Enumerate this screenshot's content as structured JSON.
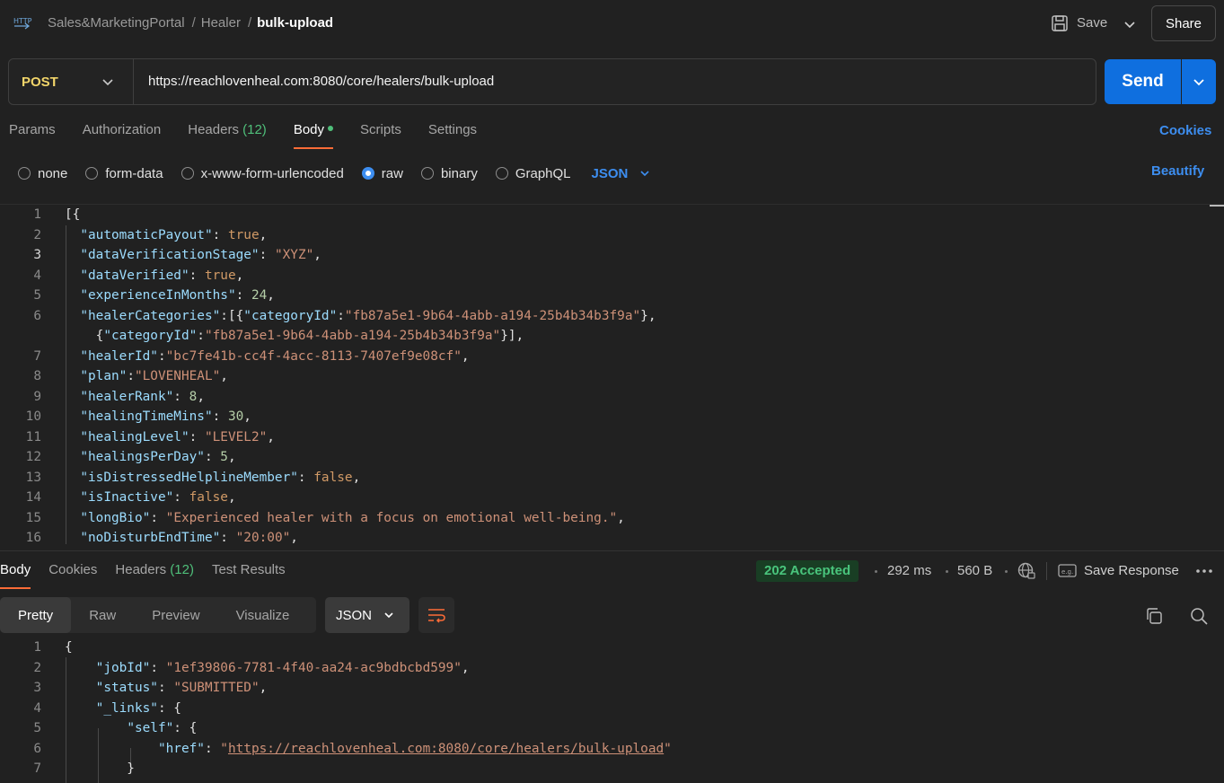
{
  "breadcrumb": {
    "collection": "Sales&MarketingPortal",
    "folder": "Healer",
    "request": "bulk-upload",
    "separator": "/"
  },
  "toolbar": {
    "save_label": "Save",
    "share_label": "Share"
  },
  "request": {
    "method": "POST",
    "url": "https://reachlovenheal.com:8080/core/healers/bulk-upload",
    "send_label": "Send"
  },
  "request_tabs": {
    "params": "Params",
    "authorization": "Authorization",
    "headers": "Headers",
    "headers_count": "(12)",
    "body": "Body",
    "scripts": "Scripts",
    "settings": "Settings",
    "cookies": "Cookies"
  },
  "body_options": {
    "none": "none",
    "form_data": "form-data",
    "urlencoded": "x-www-form-urlencoded",
    "raw": "raw",
    "binary": "binary",
    "graphql": "GraphQL",
    "selected": "raw",
    "format": "JSON",
    "beautify": "Beautify"
  },
  "request_body_lines": [
    {
      "n": "1",
      "text": "[{"
    },
    {
      "n": "2",
      "text": "  \"automaticPayout\": true,"
    },
    {
      "n": "3",
      "text": "  \"dataVerificationStage\": \"XYZ\","
    },
    {
      "n": "4",
      "text": "  \"dataVerified\": true,"
    },
    {
      "n": "5",
      "text": "  \"experienceInMonths\": 24,"
    },
    {
      "n": "6",
      "text": "  \"healerCategories\":[{\"categoryId\":\"fb87a5e1-9b64-4abb-a194-25b4b34b3f9a\"},"
    },
    {
      "n": "",
      "text": "    {\"categoryId\":\"fb87a5e1-9b64-4abb-a194-25b4b34b3f9a\"}],"
    },
    {
      "n": "7",
      "text": "  \"healerId\":\"bc7fe41b-cc4f-4acc-8113-7407ef9e08cf\","
    },
    {
      "n": "8",
      "text": "  \"plan\":\"LOVENHEAL\","
    },
    {
      "n": "9",
      "text": "  \"healerRank\": 8,"
    },
    {
      "n": "10",
      "text": "  \"healingTimeMins\": 30,"
    },
    {
      "n": "11",
      "text": "  \"healingLevel\": \"LEVEL2\","
    },
    {
      "n": "12",
      "text": "  \"healingsPerDay\": 5,"
    },
    {
      "n": "13",
      "text": "  \"isDistressedHelplineMember\": false,"
    },
    {
      "n": "14",
      "text": "  \"isInactive\": false,"
    },
    {
      "n": "15",
      "text": "  \"longBio\": \"Experienced healer with a focus on emotional well-being.\","
    },
    {
      "n": "16",
      "text": "  \"noDisturbEndTime\": \"20:00\","
    }
  ],
  "response_tabs": {
    "body": "Body",
    "cookies": "Cookies",
    "headers": "Headers",
    "headers_count": "(12)",
    "test_results": "Test Results"
  },
  "response_meta": {
    "status": "202 Accepted",
    "time": "292 ms",
    "size": "560 B",
    "save_response": "Save Response"
  },
  "response_view": {
    "pretty": "Pretty",
    "raw": "Raw",
    "preview": "Preview",
    "visualize": "Visualize",
    "format": "JSON"
  },
  "response_body_lines": [
    {
      "n": "1",
      "text": "{"
    },
    {
      "n": "2",
      "text": "    \"jobId\": \"1ef39806-7781-4f40-aa24-ac9bdbcbd599\","
    },
    {
      "n": "3",
      "text": "    \"status\": \"SUBMITTED\","
    },
    {
      "n": "4",
      "text": "    \"_links\": {"
    },
    {
      "n": "5",
      "text": "        \"self\": {"
    },
    {
      "n": "6",
      "text": "            \"href\": \"https://reachlovenheal.com:8080/core/healers/bulk-upload\""
    },
    {
      "n": "7",
      "text": "        }"
    }
  ],
  "colors": {
    "accent_blue": "#0f6fdf",
    "tab_underline": "#ff6c37",
    "success_green": "#49c47c",
    "method_yellow": "#f2d56a"
  }
}
